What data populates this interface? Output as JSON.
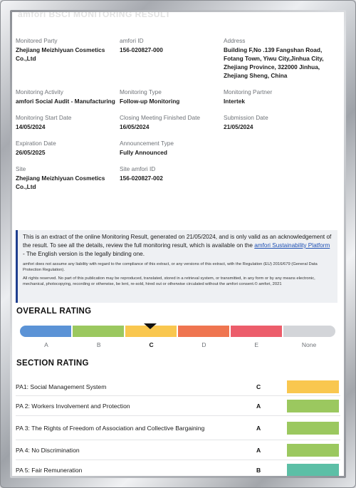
{
  "header_cut": "amfori BSCI MONITORING RESULT",
  "info_rows": [
    [
      {
        "label": "Monitored Party",
        "value": "Zhejiang Meizhiyuan Cosmetics Co.,Ltd"
      },
      {
        "label": "amfori ID",
        "value": "156-020827-000"
      },
      {
        "label": "Address",
        "value": "Building F,No .139 Fangshan Road, Fotang Town, Yiwu City,Jinhua City, Zhejiang Province, 322000 Jinhua, Zhejiang Sheng, China"
      }
    ],
    [
      {
        "label": "Monitoring Activity",
        "value": "amfori Social Audit - Manufacturing"
      },
      {
        "label": "Monitoring Type",
        "value": "Follow-up Monitoring"
      },
      {
        "label": "Monitoring Partner",
        "value": "Intertek"
      }
    ],
    [
      {
        "label": "Monitoring Start Date",
        "value": "14/05/2024"
      },
      {
        "label": "Closing Meeting Finished Date",
        "value": "16/05/2024"
      },
      {
        "label": "Submission Date",
        "value": "21/05/2024"
      }
    ],
    [
      {
        "label": "Expiration Date",
        "value": "26/05/2025"
      },
      {
        "label": "Announcement Type",
        "value": "Fully Announced"
      },
      {
        "label": "",
        "value": ""
      }
    ],
    [
      {
        "label": "Site",
        "value": "Zhejiang Meizhiyuan Cosmetics Co.,Ltd"
      },
      {
        "label": "Site amfori ID",
        "value": "156-020827-002"
      },
      {
        "label": "",
        "value": ""
      }
    ]
  ],
  "notice": {
    "text_before": "This is an extract of the online Monitoring Result, generated on 21/05/2024, and is only valid as an acknowledgement of the result. To see all the details, review the full monitoring result, which is available on the ",
    "link": "amfori Sustainability Platform",
    "text_after": " - The English version is the legally binding one.",
    "disclaimer": "amfori does not assume any liability with regard to the compliance of this extract, or any versions of this extract, with the Regulation (EU) 2016/679 (General Data Protection Regulation).",
    "rights": "All rights reserved. No part of this publication may be reproduced, translated, stored in a retrieval system, or transmitted, in any form or by any means electronic, mechanical, photocopying, recording or otherwise, be lent, re-sold, hired out or otherwise circulated without the amfori consent.© amfori, 2021"
  },
  "overall": {
    "title": "OVERALL RATING",
    "grades": [
      "A",
      "B",
      "C",
      "D",
      "E",
      "None"
    ],
    "selected": "C",
    "colors": [
      "#5b93d6",
      "#9bc85f",
      "#f9c74f",
      "#ef7550",
      "#ec5d6b",
      "#d3d5d9"
    ]
  },
  "section": {
    "title": "SECTION RATING",
    "rows": [
      {
        "name": "PA1: Social Management System",
        "grade": "C",
        "color": "#f9c74f"
      },
      {
        "name": "PA 2: Workers Involvement and Protection",
        "grade": "A",
        "color": "#9bc85f"
      },
      {
        "name": "PA 3: The Rights of Freedom of Association and Collective Bargaining",
        "grade": "A",
        "color": "#9bc85f"
      },
      {
        "name": "PA 4: No Discrimination",
        "grade": "A",
        "color": "#9bc85f"
      },
      {
        "name": "PA 5: Fair Remuneration",
        "grade": "B",
        "color": "#5cbfa6"
      }
    ]
  }
}
